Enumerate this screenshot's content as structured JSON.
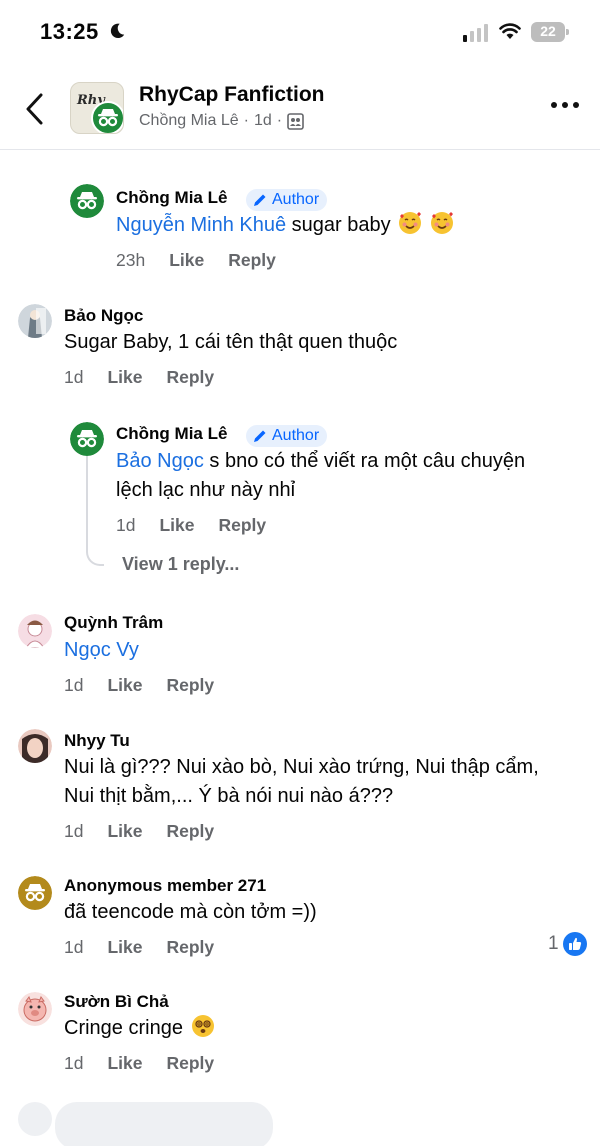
{
  "status_bar": {
    "time": "13:25",
    "battery": "22"
  },
  "header": {
    "group_name": "RhyCap Fanfiction",
    "group_avatar_text": "Rhy",
    "poster": "Chồng Mia Lê",
    "age": "1d",
    "separator": "·"
  },
  "comments": [
    {
      "name": "Chồng Mia Lê",
      "badge": "Author",
      "mention": "Nguyễn Minh Khuê",
      "text": " sugar baby",
      "emoji": "smiling-face-with-hearts",
      "time": "23h",
      "like": "Like",
      "reply": "Reply"
    },
    {
      "name": "Bảo Ngọc",
      "text": "Sugar Baby, 1 cái tên thật quen thuộc",
      "time": "1d",
      "like": "Like",
      "reply": "Reply"
    },
    {
      "name": "Chồng Mia Lê",
      "badge": "Author",
      "mention": "Bảo Ngọc",
      "text_line1": " s bno có thể viết ra một câu chuyện",
      "text_line2": "lệch lạc như này nhỉ",
      "time": "1d",
      "like": "Like",
      "reply": "Reply",
      "view_replies": "View 1 reply..."
    },
    {
      "name": "Quỳnh Trâm",
      "mention": "Ngọc Vy",
      "time": "1d",
      "like": "Like",
      "reply": "Reply"
    },
    {
      "name": "Nhyy Tu",
      "text_line1": "Nui là gì??? Nui xào bò, Nui xào trứng, Nui thập cẩm,",
      "text_line2": "Nui thịt bằm,... Ý bà nói nui nào á???",
      "time": "1d",
      "like": "Like",
      "reply": "Reply"
    },
    {
      "name": "Anonymous member 271",
      "text": "đã teencode mà còn tởm =))",
      "time": "1d",
      "like": "Like",
      "reply": "Reply",
      "reaction_count": "1",
      "reaction_icon": "like-icon"
    },
    {
      "name": "Sườn Bì Chả",
      "text": "Cringe cringe",
      "emoji": "dizzy-face",
      "time": "1d",
      "like": "Like",
      "reply": "Reply"
    }
  ],
  "colors": {
    "mention": "#1b6fe0",
    "author_badge_bg": "#e7f0fd",
    "author_badge_text": "#0866ff",
    "anon_green": "#1f8a3b",
    "anon_gold": "#b38a1c",
    "like_blue": "#1877f2",
    "meta_gray": "#65676b"
  }
}
